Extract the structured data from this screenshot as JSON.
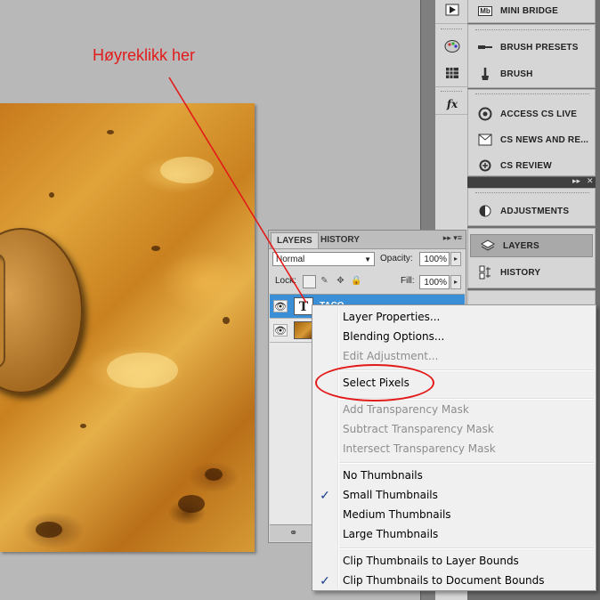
{
  "annotation": {
    "callout_text": "Høyreklikk her",
    "callout_color": "#e31a1a"
  },
  "dock": {
    "icon_column": [
      {
        "icon": "play-icon"
      },
      {
        "icon": "palette-icon"
      },
      {
        "icon": "swatches-grid-icon"
      },
      {
        "icon": "fx-icon",
        "label": "fx"
      }
    ],
    "panels": [
      {
        "icon": "mini-bridge-icon",
        "icon_text": "Mb",
        "label": "MINI BRIDGE"
      },
      {
        "icon": "brush-presets-icon",
        "label": "BRUSH PRESETS"
      },
      {
        "icon": "brush-icon",
        "label": "BRUSH"
      },
      {
        "icon": "access-cs-live-icon",
        "label": "ACCESS CS LIVE"
      },
      {
        "icon": "cs-news-icon",
        "label": "CS NEWS AND RE..."
      },
      {
        "icon": "cs-review-icon",
        "label": "CS REVIEW"
      },
      {
        "icon": "adjustments-icon",
        "label": "ADJUSTMENTS"
      },
      {
        "icon": "layers-icon",
        "label": "LAYERS",
        "active": true
      },
      {
        "icon": "history-icon",
        "label": "HISTORY"
      }
    ]
  },
  "layers_panel": {
    "tabs": [
      "LAYERS",
      "HISTORY"
    ],
    "active_tab": "LAYERS",
    "blend_mode": "Normal",
    "opacity_label": "Opacity:",
    "opacity_value": "100%",
    "lock_label": "Lock:",
    "fill_label": "Fill:",
    "fill_value": "100%",
    "layers": [
      {
        "name": "TACO",
        "type": "text",
        "thumb_text": "T",
        "selected": true
      },
      {
        "name": "",
        "type": "image",
        "selected": false
      }
    ]
  },
  "context_menu": {
    "items": [
      {
        "label": "Layer Properties...",
        "enabled": true
      },
      {
        "label": "Blending Options...",
        "enabled": true
      },
      {
        "label": "Edit Adjustment...",
        "enabled": false
      },
      {
        "separator": true
      },
      {
        "label": "Select Pixels",
        "enabled": true,
        "highlighted_by_annotation": true
      },
      {
        "separator": true
      },
      {
        "label": "Add Transparency Mask",
        "enabled": false
      },
      {
        "label": "Subtract Transparency Mask",
        "enabled": false
      },
      {
        "label": "Intersect Transparency Mask",
        "enabled": false
      },
      {
        "separator": true
      },
      {
        "label": "No Thumbnails",
        "enabled": true,
        "checked": false
      },
      {
        "label": "Small Thumbnails",
        "enabled": true,
        "checked": true
      },
      {
        "label": "Medium Thumbnails",
        "enabled": true,
        "checked": false
      },
      {
        "label": "Large Thumbnails",
        "enabled": true,
        "checked": false
      },
      {
        "separator": true
      },
      {
        "label": "Clip Thumbnails to Layer Bounds",
        "enabled": true,
        "checked": false
      },
      {
        "label": "Clip Thumbnails to Document Bounds",
        "enabled": true,
        "checked": true
      }
    ]
  }
}
